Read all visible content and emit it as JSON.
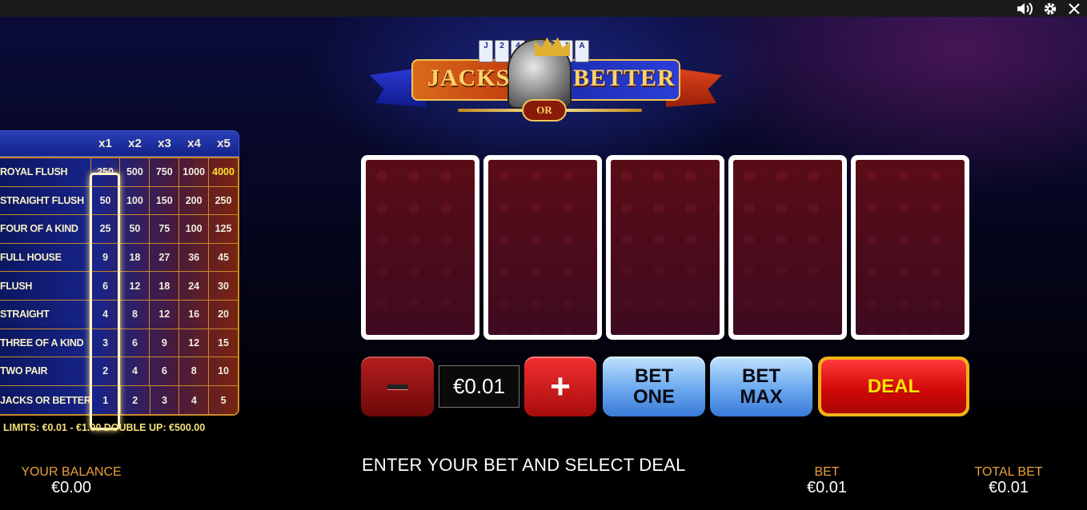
{
  "topbar": {
    "sound_icon": "speaker-icon",
    "settings_icon": "gear-icon",
    "close_icon": "close-icon"
  },
  "logo": {
    "word_left": "JACKS",
    "word_or": "OR",
    "word_right": "BETTER"
  },
  "paytable": {
    "columns": [
      "x1",
      "x2",
      "x3",
      "x4",
      "x5"
    ],
    "selected_column": "x1",
    "rows": [
      {
        "hand": "ROYAL FLUSH",
        "payouts": [
          "250",
          "500",
          "750",
          "1000",
          "4000"
        ]
      },
      {
        "hand": "STRAIGHT FLUSH",
        "payouts": [
          "50",
          "100",
          "150",
          "200",
          "250"
        ]
      },
      {
        "hand": "FOUR OF A KIND",
        "payouts": [
          "25",
          "50",
          "75",
          "100",
          "125"
        ]
      },
      {
        "hand": "FULL HOUSE",
        "payouts": [
          "9",
          "18",
          "27",
          "36",
          "45"
        ]
      },
      {
        "hand": "FLUSH",
        "payouts": [
          "6",
          "12",
          "18",
          "24",
          "30"
        ]
      },
      {
        "hand": "STRAIGHT",
        "payouts": [
          "4",
          "8",
          "12",
          "16",
          "20"
        ]
      },
      {
        "hand": "THREE OF A KIND",
        "payouts": [
          "3",
          "6",
          "9",
          "12",
          "15"
        ]
      },
      {
        "hand": "TWO PAIR",
        "payouts": [
          "2",
          "4",
          "6",
          "8",
          "10"
        ]
      },
      {
        "hand": "JACKS OR BETTER",
        "payouts": [
          "1",
          "2",
          "3",
          "4",
          "5"
        ]
      }
    ],
    "highlight_color": "#ffe32a",
    "limits": "LIMITS: €0.01 - €1.00  DOUBLE UP: €500.00"
  },
  "cards": [
    {
      "state": "face-down"
    },
    {
      "state": "face-down"
    },
    {
      "state": "face-down"
    },
    {
      "state": "face-down"
    },
    {
      "state": "face-down"
    }
  ],
  "controls": {
    "minus_icon": "minus-icon",
    "bet_value": "€0.01",
    "plus_label": "+",
    "bet_one_line1": "BET",
    "bet_one_line2": "ONE",
    "bet_max_line1": "BET",
    "bet_max_line2": "MAX",
    "deal_label": "DEAL"
  },
  "footer": {
    "balance_label": "YOUR BALANCE",
    "balance_value": "€0.00",
    "message": "ENTER YOUR BET AND SELECT DEAL",
    "bet_label": "BET",
    "bet_value": "€0.01",
    "total_bet_label": "TOTAL BET",
    "total_bet_value": "€0.01"
  },
  "colors": {
    "accent_gold": "#e8a23a",
    "deal_red": "#d40808",
    "deal_text": "#ffe600",
    "bet_blue": "#6aa8ee"
  }
}
